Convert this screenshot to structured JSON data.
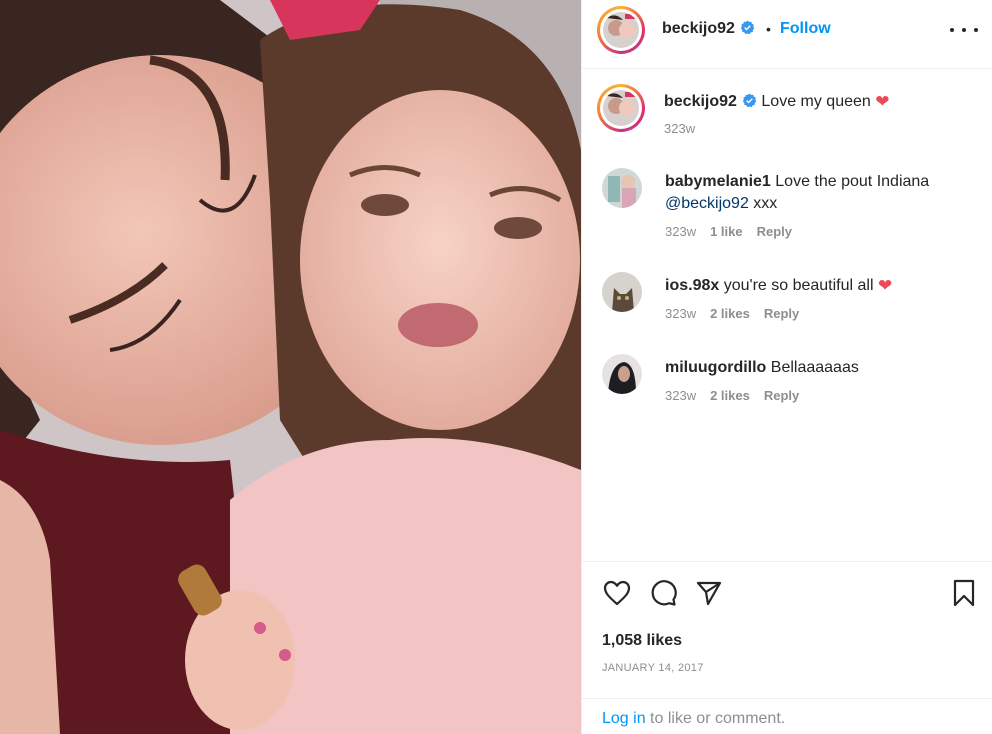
{
  "header": {
    "username": "beckijo92",
    "separator": "•",
    "follow_label": "Follow"
  },
  "caption": {
    "username": "beckijo92",
    "text": "Love my queen",
    "emoji": "❤",
    "age": "323w"
  },
  "comments": [
    {
      "username": "babymelanie1",
      "text": "Love the pout Indiana",
      "mention": "@beckijo92",
      "suffix": "xxx",
      "age": "323w",
      "likes": "1 like",
      "reply_label": "Reply"
    },
    {
      "username": "ios.98x",
      "text": "you're so beautiful all",
      "emoji": "❤",
      "age": "323w",
      "likes": "2 likes",
      "reply_label": "Reply"
    },
    {
      "username": "miluugordillo",
      "text": "Bellaaaaaas",
      "age": "323w",
      "likes": "2 likes",
      "reply_label": "Reply"
    }
  ],
  "actions": {
    "icons": [
      "heart-icon",
      "comment-icon",
      "share-icon",
      "bookmark-icon"
    ]
  },
  "likes_count": "1,058 likes",
  "date": "JANUARY 14, 2017",
  "login_prompt": {
    "link": "Log in",
    "rest": "to like or comment."
  },
  "colors": {
    "accent": "#0095f6",
    "verified": "#3897f0",
    "heart": "#ed4956",
    "muted": "#8e8e8e"
  }
}
